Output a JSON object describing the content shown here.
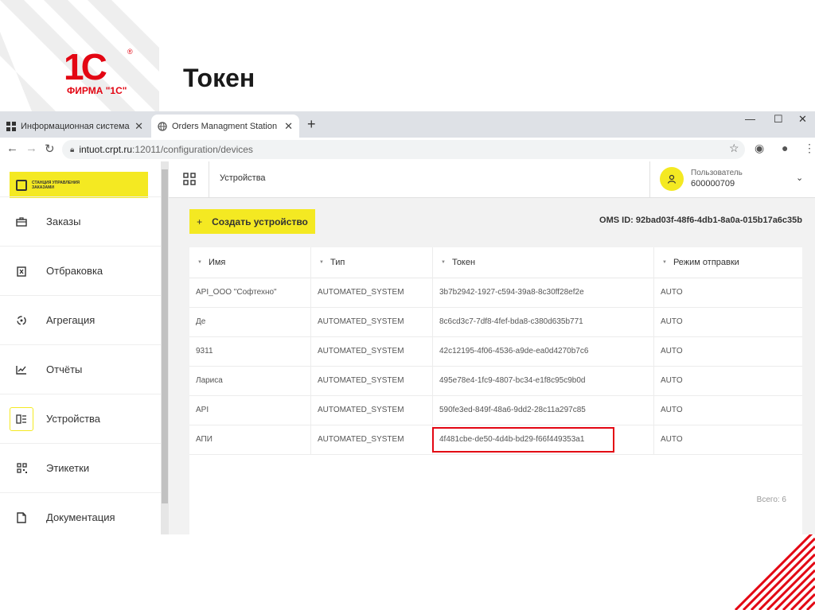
{
  "slide": {
    "title": "Токен",
    "logo_text": "ФИРМА \"1С\"",
    "accent_color": "#e30613"
  },
  "browser": {
    "tabs": [
      {
        "title": "Информационная система маркировки",
        "favicon": "grid-icon",
        "active": false
      },
      {
        "title": "Orders Managment Station",
        "favicon": "globe-icon",
        "active": true
      }
    ],
    "url_host": "intuot.crpt.ru",
    "url_path": ":12011/configuration/devices",
    "window_controls": {
      "minimize": "—",
      "maximize": "☐",
      "close": "✕"
    }
  },
  "app": {
    "brand_text": "СТАНЦИЯ УПРАВЛЕНИЯ ЗАКАЗАМИ",
    "brand_color": "#f4e922",
    "nav": [
      {
        "label": "Заказы",
        "icon": "briefcase-icon",
        "active": false
      },
      {
        "label": "Отбраковка",
        "icon": "reject-box-icon",
        "active": false
      },
      {
        "label": "Агрегация",
        "icon": "aggregation-icon",
        "active": false
      },
      {
        "label": "Отчёты",
        "icon": "chart-icon",
        "active": false
      },
      {
        "label": "Устройства",
        "icon": "devices-icon",
        "active": true
      },
      {
        "label": "Этикетки",
        "icon": "qr-icon",
        "active": false
      },
      {
        "label": "Документация",
        "icon": "document-icon",
        "active": false
      }
    ],
    "header": {
      "section": "Устройства",
      "user_label": "Пользователь",
      "user_id": "600000709"
    },
    "create_button": "Создать устройство",
    "oms_id": "OMS ID: 92bad03f-48f6-4db1-8a0a-015b17a6c35b",
    "table": {
      "columns": [
        "Имя",
        "Тип",
        "Токен",
        "Режим отправки"
      ],
      "rows": [
        {
          "name": "API_ООО \"Софтехно\"",
          "type": "AUTOMATED_SYSTEM",
          "token": "3b7b2942-1927-c594-39a8-8c30ff28ef2e",
          "mode": "AUTO"
        },
        {
          "name": "Де",
          "type": "AUTOMATED_SYSTEM",
          "token": "8c6cd3c7-7df8-4fef-bda8-c380d635b771",
          "mode": "AUTO"
        },
        {
          "name": "9311",
          "type": "AUTOMATED_SYSTEM",
          "token": "42c12195-4f06-4536-a9de-ea0d4270b7c6",
          "mode": "AUTO"
        },
        {
          "name": "Лариса",
          "type": "AUTOMATED_SYSTEM",
          "token": "495e78e4-1fc9-4807-bc34-e1f8c95c9b0d",
          "mode": "AUTO"
        },
        {
          "name": "API",
          "type": "AUTOMATED_SYSTEM",
          "token": "590fe3ed-849f-48a6-9dd2-28c11a297c85",
          "mode": "AUTO"
        },
        {
          "name": "АПИ",
          "type": "AUTOMATED_SYSTEM",
          "token": "4f481cbe-de50-4d4b-bd29-f66f449353a1",
          "mode": "AUTO"
        }
      ],
      "total": "Всего: 6",
      "highlighted_row": 5
    }
  }
}
